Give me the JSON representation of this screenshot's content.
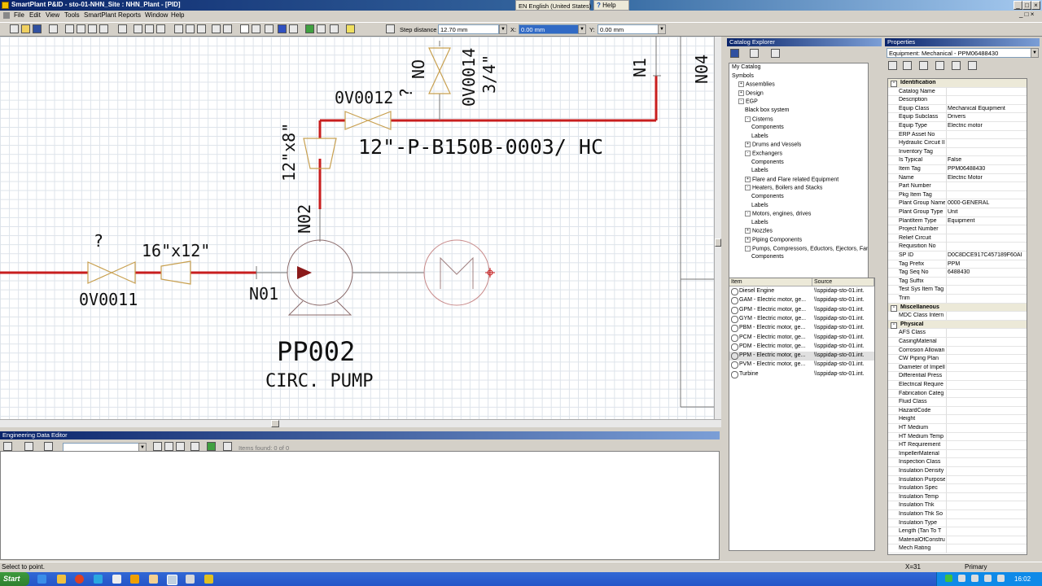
{
  "window": {
    "title": "SmartPlant P&ID - sto-01-NHN_Site : NHN_Plant - [PID]"
  },
  "language_bar": "EN English (United States)",
  "help_label": "Help",
  "menu": [
    "File",
    "Edit",
    "View",
    "Tools",
    "SmartPlant",
    "Reports",
    "Window",
    "Help"
  ],
  "toolbar": {
    "step_distance_label": "Step distance",
    "step_distance_value": "12.70 mm",
    "x_label": "X:",
    "x_value": "0.00 mm",
    "y_label": "Y:",
    "y_value": "0.00 mm"
  },
  "drawing": {
    "valve_top_tag": "0V0014",
    "valve_top_size": "3/4\"",
    "valve_top_no": "NO",
    "valve_top_q": "?",
    "valve_mid_tag": "0V0012",
    "valve_mid_q": "?",
    "reducer_mid_size": "12\"x8\"",
    "line_number": "12\"-P-B150B-0003/ HC",
    "nozzle_n02": "N02",
    "nozzle_n01": "N01",
    "nozzle_n1": "N1",
    "nozzle_n04": "N04",
    "valve_left_q": "?",
    "reducer_left_size": "16\"x12\"",
    "valve_left_tag": "0V0011",
    "pump_tag": "PP002",
    "pump_desc": "CIRC. PUMP"
  },
  "ede": {
    "title": "Engineering Data Editor",
    "items_found": "Items found: 0 of 0"
  },
  "catalog": {
    "title": "Catalog Explorer",
    "tree": [
      {
        "label": "My Catalog",
        "indent": 0,
        "pm": ""
      },
      {
        "label": "Symbols",
        "indent": 0,
        "pm": ""
      },
      {
        "label": "Assemblies",
        "indent": 1,
        "pm": "+"
      },
      {
        "label": "Design",
        "indent": 1,
        "pm": "+"
      },
      {
        "label": "EGP",
        "indent": 1,
        "pm": "-"
      },
      {
        "label": "Black box system",
        "indent": 2,
        "pm": ""
      },
      {
        "label": "Cisterns",
        "indent": 2,
        "pm": "-"
      },
      {
        "label": "Components",
        "indent": 3,
        "pm": ""
      },
      {
        "label": "Labels",
        "indent": 3,
        "pm": ""
      },
      {
        "label": "Drums and Vessels",
        "indent": 2,
        "pm": "+"
      },
      {
        "label": "Exchangers",
        "indent": 2,
        "pm": "-"
      },
      {
        "label": "Components",
        "indent": 3,
        "pm": ""
      },
      {
        "label": "Labels",
        "indent": 3,
        "pm": ""
      },
      {
        "label": "Flare and Flare related Equipment",
        "indent": 2,
        "pm": "+"
      },
      {
        "label": "Heaters, Boilers and Stacks",
        "indent": 2,
        "pm": "-"
      },
      {
        "label": "Components",
        "indent": 3,
        "pm": ""
      },
      {
        "label": "Labels",
        "indent": 3,
        "pm": ""
      },
      {
        "label": "Motors, engines, drives",
        "indent": 2,
        "pm": "-"
      },
      {
        "label": "Labels",
        "indent": 3,
        "pm": ""
      },
      {
        "label": "Nozzles",
        "indent": 2,
        "pm": "+"
      },
      {
        "label": "Piping Components",
        "indent": 2,
        "pm": "+"
      },
      {
        "label": "Pumps, Compressors, Eductors, Ejectors, Fans",
        "indent": 2,
        "pm": "-"
      },
      {
        "label": "Components",
        "indent": 3,
        "pm": ""
      }
    ],
    "item_header": "Item",
    "source_header": "Source",
    "items": [
      {
        "item": "Diesel Engine",
        "source": "\\\\sppidap-sto-01.int."
      },
      {
        "item": "GAM - Electric motor, ge...",
        "source": "\\\\sppidap-sto-01.int."
      },
      {
        "item": "GPM - Electric motor, ge...",
        "source": "\\\\sppidap-sto-01.int."
      },
      {
        "item": "GYM - Electric motor, ge...",
        "source": "\\\\sppidap-sto-01.int."
      },
      {
        "item": "PBM - Electric motor, ge...",
        "source": "\\\\sppidap-sto-01.int."
      },
      {
        "item": "PCM - Electric motor, ge...",
        "source": "\\\\sppidap-sto-01.int."
      },
      {
        "item": "PDM - Electric motor, ge...",
        "source": "\\\\sppidap-sto-01.int."
      },
      {
        "item": "PPM - Electric motor, ge...",
        "source": "\\\\sppidap-sto-01.int."
      },
      {
        "item": "PVM - Electric motor, ge...",
        "source": "\\\\sppidap-sto-01.int."
      },
      {
        "item": "Turbine",
        "source": "\\\\sppidap-sto-01.int."
      }
    ]
  },
  "properties": {
    "title": "Properties",
    "selector": "Equipment: Mechanical - PPM06488430",
    "rows": [
      {
        "n": "Identification",
        "v": "",
        "cat": true
      },
      {
        "n": "Catalog Name",
        "v": ""
      },
      {
        "n": "Description",
        "v": ""
      },
      {
        "n": "Equip Class",
        "v": "Mechanical Equipment"
      },
      {
        "n": "Equip Subclass",
        "v": "Drivers"
      },
      {
        "n": "Equip Type",
        "v": "Electric motor"
      },
      {
        "n": "ERP Asset No",
        "v": ""
      },
      {
        "n": "Hydraulic Circuit II",
        "v": ""
      },
      {
        "n": "Inventory Tag",
        "v": ""
      },
      {
        "n": "Is Typical",
        "v": "False"
      },
      {
        "n": "Item Tag",
        "v": "PPM06488430"
      },
      {
        "n": "Name",
        "v": "Electric Motor"
      },
      {
        "n": "Part Number",
        "v": ""
      },
      {
        "n": "Pkg Item Tag",
        "v": ""
      },
      {
        "n": "Plant Group Name",
        "v": "0000-GENERAL"
      },
      {
        "n": "Plant Group Type",
        "v": "Unit"
      },
      {
        "n": "PlantItem Type",
        "v": "Equipment"
      },
      {
        "n": "Project Number",
        "v": ""
      },
      {
        "n": "Relief Circuit",
        "v": ""
      },
      {
        "n": "Requisition No",
        "v": ""
      },
      {
        "n": "SP ID",
        "v": "D0C8DCE917C457189F60AI"
      },
      {
        "n": "Tag Prefix",
        "v": "PPM"
      },
      {
        "n": "Tag Seq No",
        "v": "6488430"
      },
      {
        "n": "Tag Suffix",
        "v": ""
      },
      {
        "n": "Test Sys Item Tag",
        "v": ""
      },
      {
        "n": "Trim",
        "v": ""
      },
      {
        "n": "Miscellaneous",
        "v": "",
        "cat": true
      },
      {
        "n": "MDC Class Intern",
        "v": ""
      },
      {
        "n": "Physical",
        "v": "",
        "cat": true
      },
      {
        "n": "AFS Class",
        "v": ""
      },
      {
        "n": "CasingMaterial",
        "v": ""
      },
      {
        "n": "Corrosion Allowan",
        "v": ""
      },
      {
        "n": "CW Piping Plan",
        "v": ""
      },
      {
        "n": "Diameter of Impell",
        "v": ""
      },
      {
        "n": "Differential Press",
        "v": ""
      },
      {
        "n": "Electrical Require",
        "v": ""
      },
      {
        "n": "Fabrication Categ",
        "v": ""
      },
      {
        "n": "Fluid Class",
        "v": ""
      },
      {
        "n": "HazardCode",
        "v": ""
      },
      {
        "n": "Height",
        "v": ""
      },
      {
        "n": "HT Medium",
        "v": ""
      },
      {
        "n": "HT Medium Temp",
        "v": ""
      },
      {
        "n": "HT Requirement",
        "v": ""
      },
      {
        "n": "ImpellerMaterial",
        "v": ""
      },
      {
        "n": "Inspection Class",
        "v": ""
      },
      {
        "n": "Insulation Density",
        "v": ""
      },
      {
        "n": "Insulation Purpose",
        "v": ""
      },
      {
        "n": "Insulation Spec",
        "v": ""
      },
      {
        "n": "Insulation Temp",
        "v": ""
      },
      {
        "n": "Insulation Thk",
        "v": ""
      },
      {
        "n": "Insulation Thk So",
        "v": ""
      },
      {
        "n": "Insulation Type",
        "v": ""
      },
      {
        "n": "Length (Tan To T",
        "v": ""
      },
      {
        "n": "MaterialOfConstru",
        "v": ""
      },
      {
        "n": "Mech Rating",
        "v": ""
      }
    ]
  },
  "status": {
    "message": "Select to point.",
    "coord": "X=31",
    "mode": "Primary"
  },
  "taskbar": {
    "start": "Start",
    "clock": "16:02"
  },
  "colors": {
    "pipe": "#c81e1e",
    "symbol": "#c8a050",
    "title_dark": "#0a246a"
  }
}
